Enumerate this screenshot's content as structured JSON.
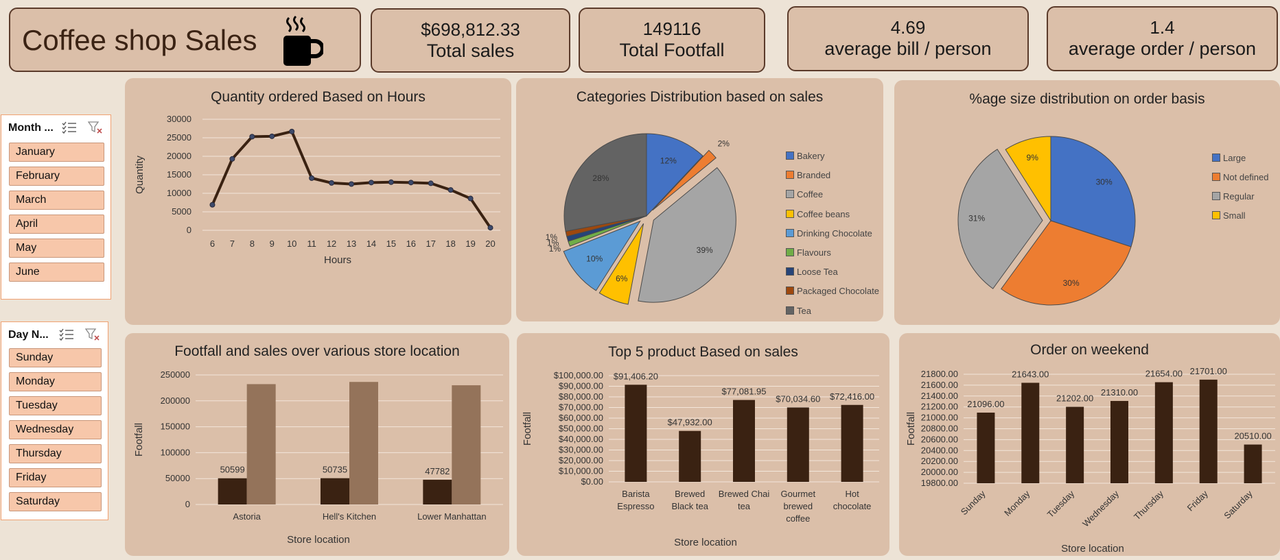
{
  "header": {
    "title": "Coffee shop Sales",
    "kpis": [
      {
        "value": "$698,812.33",
        "label": "Total sales"
      },
      {
        "value": "149116",
        "label": "Total Footfall"
      },
      {
        "value": "4.69",
        "label": "average bill / person"
      },
      {
        "value": "1.4",
        "label": "average order / person"
      }
    ]
  },
  "slicers": {
    "month": {
      "title": "Month ...",
      "items": [
        "January",
        "February",
        "March",
        "April",
        "May",
        "June"
      ]
    },
    "day": {
      "title": "Day N...",
      "items": [
        "Sunday",
        "Monday",
        "Tuesday",
        "Wednesday",
        "Thursday",
        "Friday",
        "Saturday"
      ]
    }
  },
  "colors": {
    "dark": "#3a2212",
    "light": "#94735a",
    "panel": "#dbbfa9",
    "blue": "#4472c4",
    "orange": "#ed7d31",
    "gray": "#a5a5a5",
    "yellow": "#ffc000",
    "lightblue": "#5b9bd5",
    "green": "#70ad47",
    "navy": "#264478",
    "brown": "#9e480e",
    "darkgray": "#636363"
  },
  "chart_data": [
    {
      "id": "hours",
      "type": "line",
      "title": "Quantity ordered Based on Hours",
      "xlabel": "Hours",
      "ylabel": "Quantity",
      "categories": [
        "6",
        "7",
        "8",
        "9",
        "10",
        "11",
        "12",
        "13",
        "14",
        "15",
        "16",
        "17",
        "18",
        "19",
        "20"
      ],
      "values": [
        6900,
        19300,
        25300,
        25400,
        26700,
        14100,
        12800,
        12500,
        12900,
        13000,
        12900,
        12700,
        10900,
        8600,
        700
      ],
      "ylim": [
        0,
        30000
      ],
      "yticks": [
        "0",
        "5000",
        "10000",
        "15000",
        "20000",
        "25000",
        "30000"
      ]
    },
    {
      "id": "categories",
      "type": "pie",
      "title": "Categories Distribution based on sales",
      "labels": [
        "Bakery",
        "Branded",
        "Coffee",
        "Coffee beans",
        "Drinking Chocolate",
        "Flavours",
        "Loose Tea",
        "Packaged Chocolate",
        "Tea"
      ],
      "values": [
        12,
        2,
        39,
        6,
        10,
        1,
        1,
        1,
        28
      ],
      "data_labels": [
        "12%",
        "2%",
        "39%",
        "6%",
        "10%",
        "1%",
        "1%",
        "1%",
        "28%"
      ]
    },
    {
      "id": "sizes",
      "type": "pie",
      "title": "%age size distribution on order basis",
      "labels": [
        "Large",
        "Not defined",
        "Regular",
        "Small"
      ],
      "values": [
        30,
        30,
        31,
        9
      ],
      "data_labels": [
        "30%",
        "30%",
        "31%",
        "9%"
      ]
    },
    {
      "id": "stores",
      "type": "bar",
      "title": "Footfall and sales over various store location",
      "xlabel": "Store location",
      "ylabel": "Footfall",
      "categories": [
        "Astoria",
        "Hell's Kitchen",
        "Lower Manhattan"
      ],
      "series": [
        {
          "values": [
            50599,
            50735,
            47782
          ],
          "data_labels": [
            "50599",
            "50735",
            "47782"
          ]
        },
        {
          "values": [
            232244,
            236511,
            230057
          ]
        }
      ],
      "ylim": [
        0,
        250000
      ],
      "yticks": [
        "0",
        "50000",
        "100000",
        "150000",
        "200000",
        "250000"
      ]
    },
    {
      "id": "products",
      "type": "bar",
      "title": "Top 5 product Based on sales",
      "xlabel": "Store location",
      "ylabel": "Footfall",
      "categories": [
        [
          "Barista",
          "Espresso"
        ],
        [
          "Brewed",
          "Black tea"
        ],
        [
          "Brewed Chai",
          "tea"
        ],
        [
          "Gourmet",
          "brewed",
          "coffee"
        ],
        [
          "Hot",
          "chocolate"
        ]
      ],
      "values": [
        91406.2,
        47932.0,
        77081.95,
        70034.6,
        72416.0
      ],
      "data_labels": [
        "$91,406.20",
        "$47,932.00",
        "$77,081.95",
        "$70,034.60",
        "$72,416.00"
      ],
      "ylim": [
        0,
        100000
      ],
      "yticks": [
        "$0.00",
        "$10,000.00",
        "$20,000.00",
        "$30,000.00",
        "$40,000.00",
        "$50,000.00",
        "$60,000.00",
        "$70,000.00",
        "$80,000.00",
        "$90,000.00",
        "$100,000.00"
      ]
    },
    {
      "id": "weekend",
      "type": "bar",
      "title": "Order on weekend",
      "xlabel": "Store location",
      "ylabel": "Footfall",
      "categories": [
        "Sunday",
        "Monday",
        "Tuesday",
        "Wednesday",
        "Thursday",
        "Friday",
        "Saturday"
      ],
      "values": [
        21096,
        21643,
        21202,
        21310,
        21654,
        21701,
        20510
      ],
      "data_labels": [
        "21096.00",
        "21643.00",
        "21202.00",
        "21310.00",
        "21654.00",
        "21701.00",
        "20510.00"
      ],
      "ylim": [
        19800,
        21800
      ],
      "yticks": [
        "19800.00",
        "20000.00",
        "20200.00",
        "20400.00",
        "20600.00",
        "20800.00",
        "21000.00",
        "21200.00",
        "21400.00",
        "21600.00",
        "21800.00"
      ]
    }
  ]
}
